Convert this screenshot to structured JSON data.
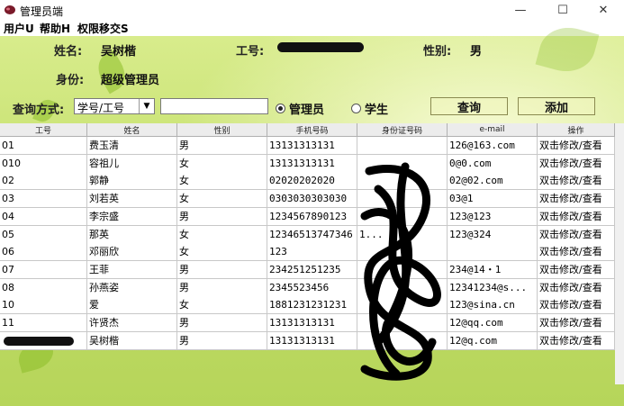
{
  "window": {
    "title": "管理员端",
    "minimize": "—",
    "maximize": "☐",
    "close": "✕"
  },
  "menu": [
    "用户U",
    "帮助H",
    "权限移交S"
  ],
  "profile": {
    "name_label": "姓名:",
    "name_value": "吴树楷",
    "id_label": "工号:",
    "gender_label": "性别:",
    "gender_value": "男",
    "role_label": "身份:",
    "role_value": "超级管理员"
  },
  "search": {
    "label": "查询方式:",
    "mode_value": "学号/工号",
    "input_value": "",
    "radio_admin": "管理员",
    "radio_student": "学生",
    "query_button": "查询",
    "add_button": "添加"
  },
  "table": {
    "columns": [
      "工号",
      "姓名",
      "性别",
      "手机号码",
      "身份证号码",
      "e-mail",
      "操作"
    ],
    "rows": [
      [
        "01",
        "费玉清",
        "男",
        "13131313131",
        "",
        "126@163.com",
        "双击修改/查看"
      ],
      [
        "010",
        "容祖儿",
        "女",
        "13131313131",
        "",
        "0@0.com",
        "双击修改/查看"
      ],
      [
        "02",
        "郭静",
        "女",
        "02020202020",
        "",
        "02@02.com",
        "双击修改/查看"
      ],
      [
        "03",
        "刘若英",
        "女",
        "0303030303030",
        "",
        "03@1",
        "双击修改/查看"
      ],
      [
        "04",
        "李宗盛",
        "男",
        "1234567890123",
        "",
        "123@123",
        "双击修改/查看"
      ],
      [
        "05",
        "那英",
        "女",
        "12346513747346",
        "1...",
        "123@324",
        "双击修改/查看"
      ],
      [
        "06",
        "邓丽欣",
        "女",
        "123",
        "",
        "",
        "双击修改/查看"
      ],
      [
        "07",
        "王菲",
        "男",
        "234251251235",
        "",
        "234@14・1",
        "双击修改/查看"
      ],
      [
        "08",
        "孙燕姿",
        "男",
        "2345523456",
        "",
        "12341234@s...",
        "双击修改/查看"
      ],
      [
        "10",
        "爱",
        "女",
        "1881231231231",
        "",
        "123@sina.cn",
        "双击修改/查看"
      ],
      [
        "11",
        "许贤杰",
        "男",
        "13131313131",
        "",
        "12@qq.com",
        "双击修改/查看"
      ],
      [
        "",
        "吴树楷",
        "男",
        "13131313131",
        "",
        "12@q.com",
        "双击修改/查看"
      ]
    ]
  }
}
